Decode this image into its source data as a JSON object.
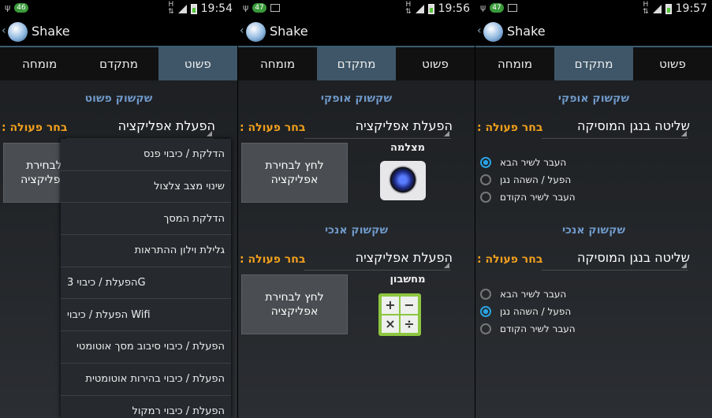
{
  "app_title": "Shake",
  "tabs": [
    "פשוט",
    "מתקדם",
    "מומחה"
  ],
  "choose_action": ": בחר פעולה",
  "press_button": "לחץ לבחירת אפליקציה",
  "phone1": {
    "status": {
      "badge": "46",
      "net": "H",
      "time": "19:54"
    },
    "section_title": "שקשוק פשוט",
    "spinner": "הפעלת אפליקציה",
    "button_partial": "לבחירת אפליקציה",
    "menu": [
      "הדלקת / כיבוי פנס",
      "שינוי מצב צלצול",
      "הדלקת המסך",
      "גלילת וילון ההתראות",
      "הפעלת / כיבוי 3G",
      "הפעלת / כיבוי Wifi",
      "הפעלת / כיבוי סיבוב מסך אוטומטי",
      "הפעלת / כיבוי בהירות אוטומטית",
      "הפעלת / כיבוי רמקול"
    ]
  },
  "phone2": {
    "status": {
      "badge": "47",
      "net": "H",
      "time": "19:56"
    },
    "horizontal": {
      "title": "שקשוק אופקי",
      "spinner": "הפעלת אפליקציה",
      "app": "מצלמה",
      "icon": "camera-icon"
    },
    "vertical": {
      "title": "שקשוק אנכי",
      "spinner": "הפעלת אפליקציה",
      "app": "מחשבון",
      "icon": "calculator-icon"
    },
    "calc_keys": [
      "+",
      "−",
      "×",
      "÷"
    ]
  },
  "phone3": {
    "status": {
      "badge": "47",
      "net": "H",
      "time": "19:57"
    },
    "horizontal": {
      "title": "שקשוק אופקי",
      "spinner": "שליטה בנגן המוסיקה",
      "selected": 0
    },
    "vertical": {
      "title": "שקשוק אנכי",
      "spinner": "שליטה בנגן המוסיקה",
      "selected": 1
    },
    "options": [
      "העבר לשיר הבא",
      "הפעל / השהה נגן",
      "העבר לשיר הקודם"
    ]
  },
  "colors": {
    "accent": "#f2a01c",
    "section": "#6f99c9",
    "tab_selected": "#3e5668",
    "radio": "#29a3e3"
  }
}
